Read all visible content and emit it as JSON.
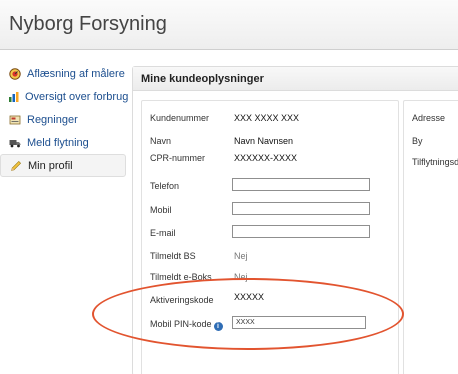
{
  "app": {
    "title": "Nyborg Forsyning"
  },
  "sidebar": {
    "items": [
      {
        "label": "Aflæsning af målere",
        "icon": "meter-gauge-icon",
        "active": false
      },
      {
        "label": "Oversigt over forbrug",
        "icon": "bar-chart-icon",
        "active": false
      },
      {
        "label": "Regninger",
        "icon": "invoice-icon",
        "active": false
      },
      {
        "label": "Meld flytning",
        "icon": "moving-truck-icon",
        "active": false
      },
      {
        "label": "Min profil",
        "icon": "pencil-icon",
        "active": true
      }
    ]
  },
  "panel": {
    "title": "Mine kundeoplysninger"
  },
  "customer": {
    "kundenummer": {
      "label": "Kundenummer",
      "value": "XXX XXXX XXX"
    },
    "navn": {
      "label": "Navn",
      "value": "Navn Navnsen"
    },
    "cpr": {
      "label": "CPR-nummer",
      "value": "XXXXXX-XXXX"
    },
    "telefon": {
      "label": "Telefon",
      "value": ""
    },
    "mobil": {
      "label": "Mobil",
      "value": ""
    },
    "email": {
      "label": "E-mail",
      "value": ""
    },
    "tilmeldt_bs": {
      "label": "Tilmeldt BS",
      "value": "Nej"
    },
    "tilmeldt_eboks": {
      "label": "Tilmeldt e-Boks",
      "value": "Nej"
    },
    "aktiveringskode": {
      "label": "Aktiveringskode",
      "value": "XXXXX"
    },
    "mobil_pin": {
      "label": "Mobil PIN-kode",
      "value": "XXXX",
      "info_icon": "info-icon"
    }
  },
  "address": {
    "adresse_label": "Adresse",
    "by_label": "By",
    "tilflytning_label": "Tilflytningsdato"
  },
  "colors": {
    "highlight": "#e2542f",
    "link": "#1d4f8f",
    "info": "#2f6db5"
  }
}
